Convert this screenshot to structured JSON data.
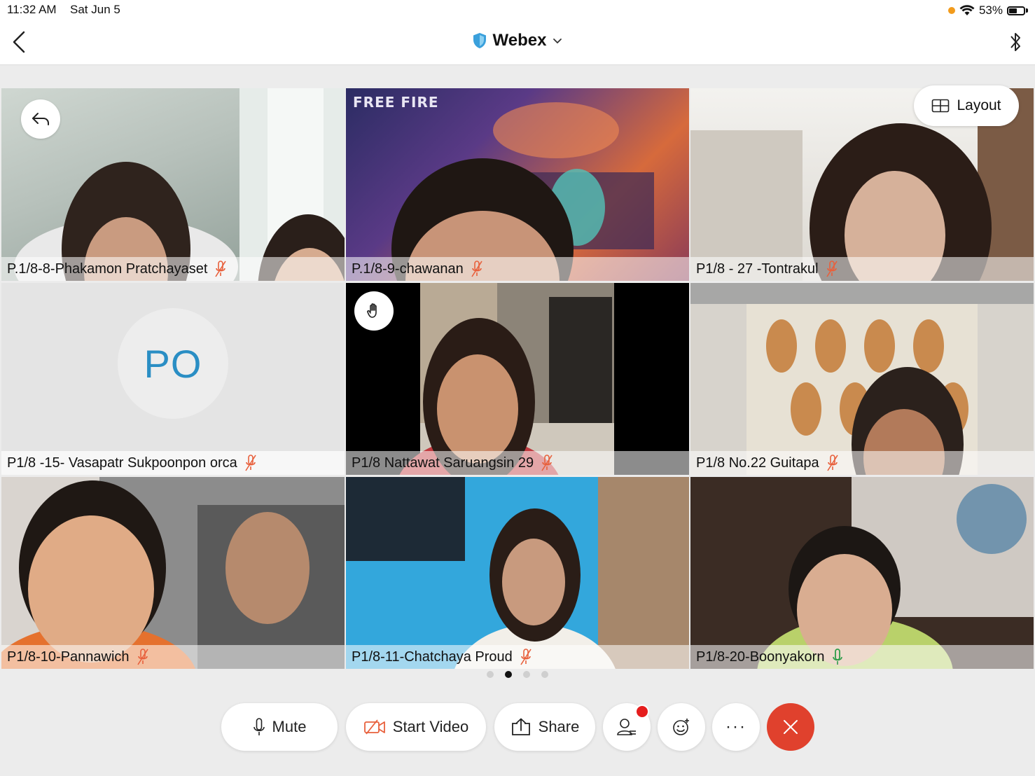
{
  "status_bar": {
    "time": "11:32 AM",
    "date": "Sat Jun 5",
    "battery": "53%",
    "battery_level": 0.53
  },
  "nav": {
    "title": "Webex"
  },
  "layout_button": {
    "label": "Layout"
  },
  "participants": [
    {
      "name": "P.1/8-8-Phakamon Pratchayaset",
      "mic": "muted"
    },
    {
      "name": "P.1/8-9-chawanan",
      "mic": "muted",
      "background_text": "FREE FIRE"
    },
    {
      "name": "P1/8 - 27 -Tontrakul",
      "mic": "muted"
    },
    {
      "name": "P1/8 -15- Vasapatr Sukpoonpon orca",
      "mic": "muted",
      "initials": "PO"
    },
    {
      "name": "P1/8 Nattawat Saruangsin 29",
      "mic": "muted",
      "hand_raised": true
    },
    {
      "name": "P1/8 No.22 Guitapa",
      "mic": "muted"
    },
    {
      "name": "P1/8-10-Pannawich",
      "mic": "muted"
    },
    {
      "name": "P1/8-11-Chatchaya Proud",
      "mic": "muted"
    },
    {
      "name": "P1/8-20-Boonyakorn",
      "mic": "on"
    }
  ],
  "pagination": {
    "pages": 4,
    "current": 2
  },
  "controls": {
    "mute_label": "Mute",
    "video_label": "Start Video",
    "share_label": "Share",
    "participants_icon": "participants-icon",
    "reactions_icon": "emoji-icon",
    "more_label": "···",
    "end_icon": "close-icon"
  },
  "colors": {
    "muted_mic": "#e8603c",
    "active_mic": "#2e9d49",
    "end_call": "#e0412d",
    "webex_shield": "#3aa0dc"
  }
}
